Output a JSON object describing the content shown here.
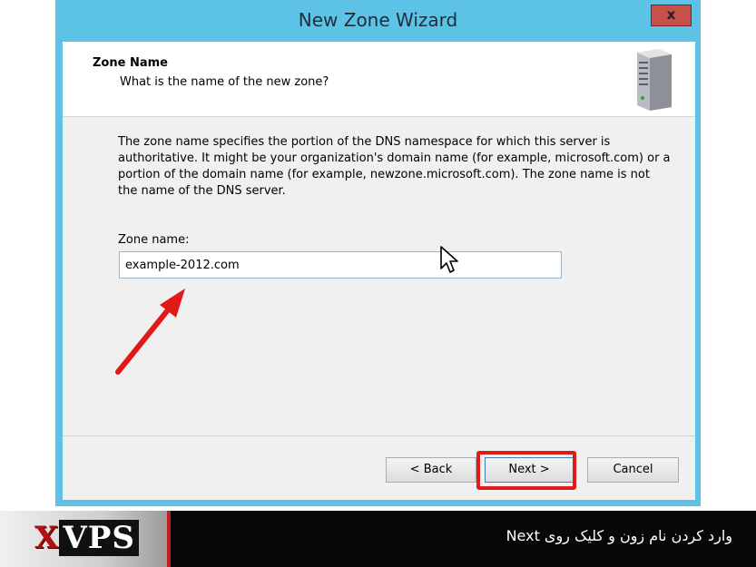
{
  "window": {
    "title": "New Zone Wizard",
    "close_label": "x"
  },
  "header": {
    "title": "Zone Name",
    "subtitle": "What is the name of the new zone?",
    "icon": "server-icon"
  },
  "body": {
    "description": "The zone name specifies the portion of the DNS namespace for which this server is authoritative. It might be your organization's domain name (for example,  microsoft.com) or a portion of the domain name (for example, newzone.microsoft.com). The zone name is not the name of the DNS server.",
    "zone_label": "Zone name:",
    "zone_value": "example-2012.com"
  },
  "buttons": {
    "back": "< Back",
    "next": "Next >",
    "cancel": "Cancel"
  },
  "banner": {
    "logo_x": "X",
    "logo_vps": "VPS",
    "caption": "وارد کردن نام زون و کلیک روی Next"
  },
  "colors": {
    "titlebar": "#5cc3e6",
    "close": "#c7504a",
    "highlight": "#e01919",
    "banner": "#070707"
  }
}
